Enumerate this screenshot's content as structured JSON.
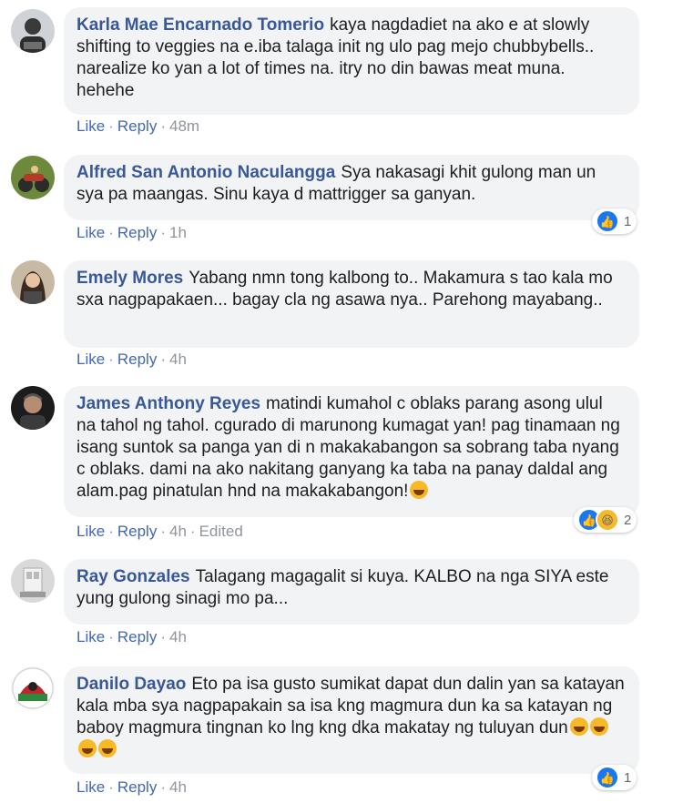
{
  "comments": [
    {
      "author": "Karla Mae Encarnado Tomerio",
      "text": "kaya nagdadiet na ako e at slowly shifting to veggies na e.iba talaga init ng ulo pag mejo chubbybells.. narealize ko yan a lot of times na. itry no din bawas meat muna. hehehe",
      "like": "Like",
      "reply": "Reply",
      "time": "48m"
    },
    {
      "author": "Alfred San Antonio Naculangga",
      "text": "Sya nakasagi khit gulong man un sya pa maangas. Sinu kaya d mattrigger sa ganyan.",
      "like": "Like",
      "reply": "Reply",
      "time": "1h",
      "reaction_count": "1"
    },
    {
      "author": "Emely Mores",
      "text": "Yabang nmn tong kalbong to.. Makamura s tao kala mo sxa nagpapakaen... bagay cla ng asawa nya.. Parehong mayabang..",
      "like": "Like",
      "reply": "Reply",
      "time": "4h"
    },
    {
      "author": "James Anthony Reyes",
      "text": "matindi kumahol c oblaks parang asong ulul na tahol ng tahol. cgurado di marunong kumagat yan! pag tinamaan ng isang suntok sa panga yan di n makakabangon sa sobrang taba nyang c oblaks. dami na ako nakitang ganyang ka taba na panay daldal ang alam.pag pinatulan hnd na makakabangon!",
      "like": "Like",
      "reply": "Reply",
      "time": "4h",
      "edited": "Edited",
      "reaction_count": "2"
    },
    {
      "author": "Ray Gonzales",
      "text": "Talagang magagalit si kuya. KALBO na nga SIYA este yung gulong sinagi mo pa...",
      "like": "Like",
      "reply": "Reply",
      "time": "4h"
    },
    {
      "author": "Danilo Dayao",
      "text": "Eto pa isa gusto sumikat dapat dun dalin yan sa katayan kala mba sya nagpapakain sa isa kng magmura dun ka sa katayan ng baboy magmura tingnan ko lng kng dka makatay ng tuluyan dun",
      "like": "Like",
      "reply": "Reply",
      "time": "4h",
      "reaction_count": "1"
    }
  ],
  "colors": {
    "author": "#385898",
    "action_link": "#4267b2",
    "bubble_bg": "#f2f3f5",
    "like_reaction": "#1877f2",
    "haha_reaction": "#f7b928"
  },
  "icons": {
    "like_reaction": "thumbs-up-icon",
    "haha_reaction": "laughing-face-icon",
    "inline_emoji": "tears-of-joy-emoji",
    "inline_emoji_2": "tongue-out-emoji"
  }
}
